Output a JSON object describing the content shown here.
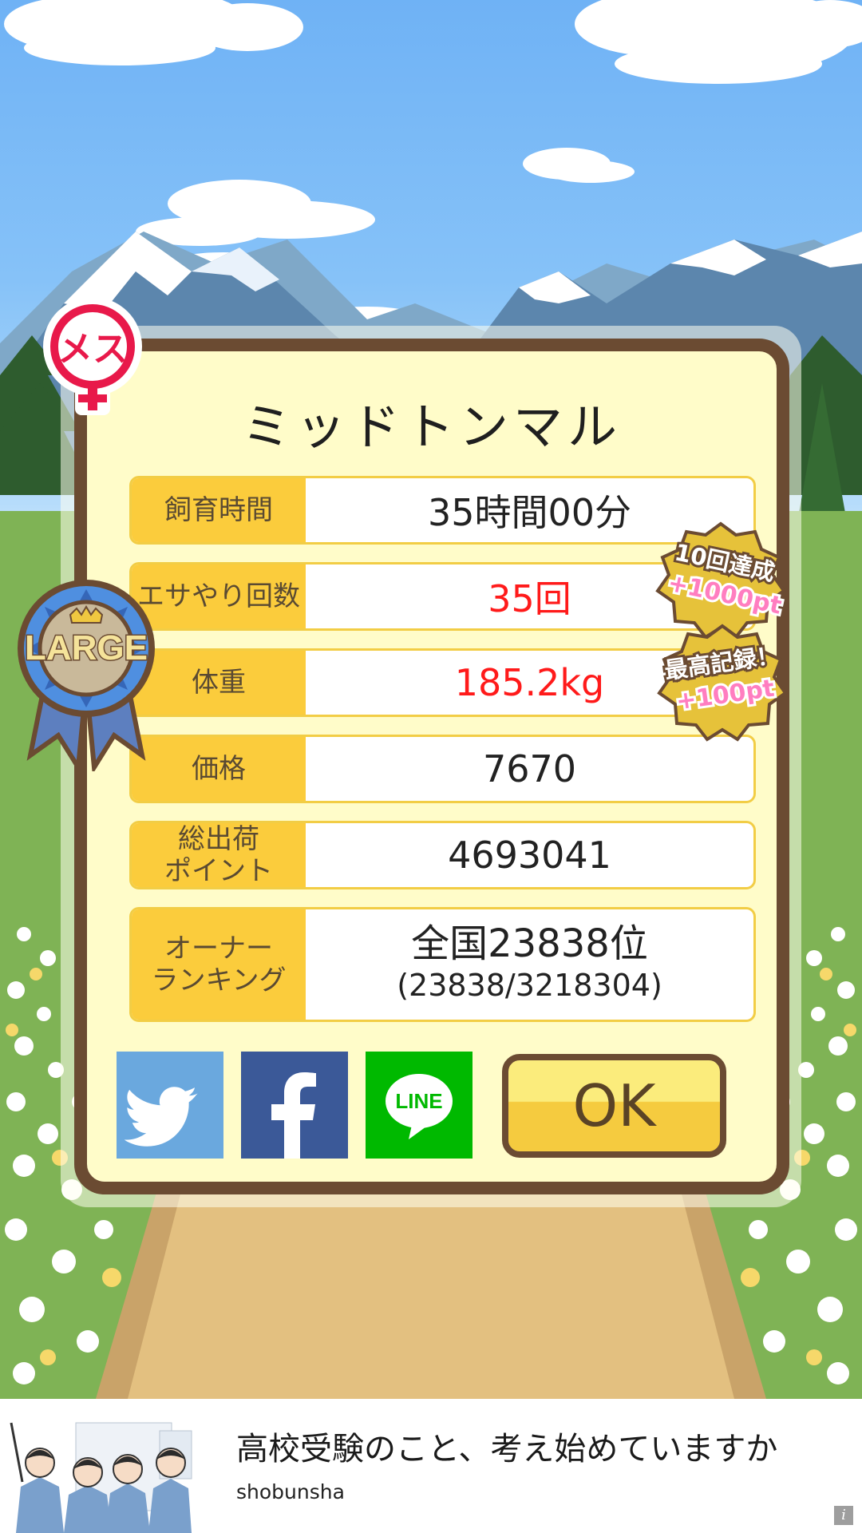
{
  "animal_name": "ミッドトンマル",
  "gender_icon": "female-icon",
  "gender_label": "メス",
  "size_ribbon": {
    "icon": "large-ribbon-icon",
    "label": "LARGE"
  },
  "stats": [
    {
      "label": "飼育時間",
      "value": "35時間00分",
      "highlight": false
    },
    {
      "label": "エサやり回数",
      "value": "35回",
      "highlight": true
    },
    {
      "label": "体重",
      "value": "185.2kg",
      "highlight": true
    },
    {
      "label": "価格",
      "value": "7670",
      "highlight": false
    },
    {
      "label_line1": "総出荷",
      "label_line2": "ポイント",
      "value": "4693041",
      "highlight": false
    }
  ],
  "ranking": {
    "label_line1": "オーナー",
    "label_line2": "ランキング",
    "rank_text": "全国23838位",
    "detail_text": "(23838/3218304)"
  },
  "bonus_badges": [
    {
      "line1": "10回達成",
      "line2": "+1000pt"
    },
    {
      "line1": "最高記録！",
      "line2": "+100pt"
    }
  ],
  "share_buttons": [
    {
      "name": "twitter",
      "icon": "twitter-bird-icon",
      "color": "#6aa8de"
    },
    {
      "name": "facebook",
      "icon": "facebook-f-icon",
      "color": "#3b5998"
    },
    {
      "name": "line",
      "icon": "line-icon",
      "label": "LINE",
      "color": "#00b900"
    }
  ],
  "ok_label": "OK",
  "ad": {
    "title": "高校受験のこと、考え始めていますか",
    "advertiser": "shobunsha",
    "info_icon": "i"
  },
  "colors": {
    "card_border": "#6b4b32",
    "card_bg": "#fffcc9",
    "label_bg": "#fbcc3c",
    "highlight_value": "#ff1a1a",
    "badge_gold": "#e6c23a",
    "badge_text": "#ff7ec0"
  }
}
